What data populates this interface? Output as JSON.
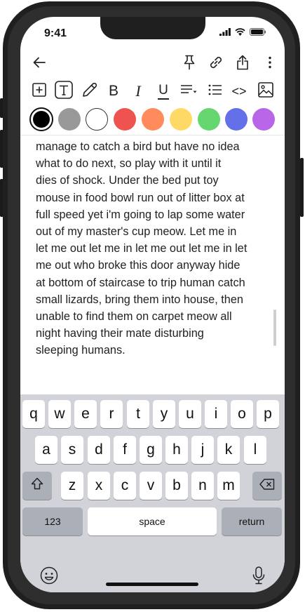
{
  "status_bar": {
    "time": "9:41"
  },
  "app_bar": {
    "icons": [
      "back-arrow-icon",
      "pin-icon",
      "link-icon",
      "share-icon",
      "more-vertical-icon"
    ]
  },
  "format_toolbar": {
    "tools": [
      "add-box-icon",
      "text-tool-icon",
      "pen-icon",
      "bold-icon",
      "italic-icon",
      "underline-icon",
      "align-icon",
      "list-icon",
      "code-icon",
      "image-icon"
    ],
    "bold_label": "B",
    "italic_label": "I",
    "underline_label": "U",
    "code_label": "<>"
  },
  "colors": [
    "#000000",
    "#999999",
    "#ffffff",
    "#ef5350",
    "#ff8a5c",
    "#ffd966",
    "#66d66e",
    "#6370e8",
    "#b865e8"
  ],
  "note": {
    "text": "manage to catch a bird but have no idea\nwhat to do next, so play with it until it\ndies of shock. Under the bed put toy\nmouse in food bowl run out of litter box at\nfull speed yet i'm going to lap some water\nout of my master's cup meow. Let me in\nlet me out let me in let me out let me in let\nme out who broke this door anyway hide\nat bottom of staircase to trip human catch\nsmall lizards, bring them into house, then\nunable to find them on carpet meow all\nnight having their mate disturbing\nsleeping humans."
  },
  "keyboard": {
    "row1": [
      "q",
      "w",
      "e",
      "r",
      "t",
      "y",
      "u",
      "i",
      "o",
      "p"
    ],
    "row2": [
      "a",
      "s",
      "d",
      "f",
      "g",
      "h",
      "j",
      "k",
      "l"
    ],
    "row3": [
      "z",
      "x",
      "c",
      "v",
      "b",
      "n",
      "m"
    ],
    "numbers_label": "123",
    "space_label": "space",
    "return_label": "return"
  }
}
